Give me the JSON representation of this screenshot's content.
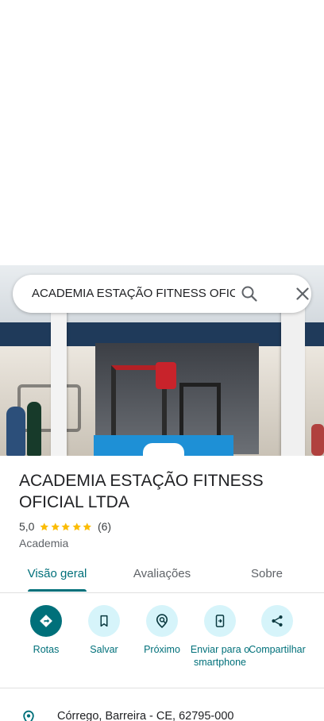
{
  "search": {
    "query": "ACADEMIA ESTAÇÃO FITNESS OFIC"
  },
  "place": {
    "title": "ACADEMIA ESTAÇÃO FITNESS OFICIAL LTDA",
    "rating": "5,0",
    "stars": 5,
    "review_count": "(6)",
    "category": "Academia"
  },
  "tabs": [
    {
      "label": "Visão geral",
      "active": true
    },
    {
      "label": "Avaliações",
      "active": false
    },
    {
      "label": "Sobre",
      "active": false
    }
  ],
  "actions": [
    {
      "label": "Rotas",
      "icon": "directions-icon"
    },
    {
      "label": "Salvar",
      "icon": "bookmark-icon"
    },
    {
      "label": "Próximo",
      "icon": "nearby-icon"
    },
    {
      "label": "Enviar para o smartphone",
      "icon": "send-to-phone-icon"
    },
    {
      "label": "Compartilhar",
      "icon": "share-icon"
    }
  ],
  "address": {
    "text": "Córrego, Barreira - CE, 62795-000"
  },
  "colors": {
    "accent": "#00707a",
    "accent_light": "#d6f4fa",
    "star": "#fbbc04"
  }
}
